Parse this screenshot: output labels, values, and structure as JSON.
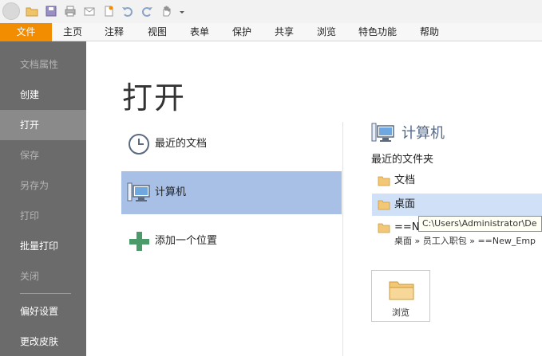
{
  "ribbon": {
    "tabs": [
      "文件",
      "主页",
      "注释",
      "视图",
      "表单",
      "保护",
      "共享",
      "浏览",
      "特色功能",
      "帮助"
    ]
  },
  "sidebar": {
    "items": [
      {
        "label": "文档属性",
        "state": "disabled"
      },
      {
        "label": "创建",
        "state": "normal"
      },
      {
        "label": "打开",
        "state": "active"
      },
      {
        "label": "保存",
        "state": "disabled"
      },
      {
        "label": "另存为",
        "state": "disabled"
      },
      {
        "label": "打印",
        "state": "disabled"
      },
      {
        "label": "批量打印",
        "state": "normal"
      },
      {
        "label": "关闭",
        "state": "disabled"
      },
      {
        "label": "偏好设置",
        "state": "normal"
      },
      {
        "label": "更改皮肤",
        "state": "normal"
      }
    ]
  },
  "main": {
    "title": "打开",
    "places": [
      {
        "label": "最近的文档",
        "icon": "clock-icon"
      },
      {
        "label": "计算机",
        "icon": "computer-icon"
      },
      {
        "label": "添加一个位置",
        "icon": "plus-icon"
      }
    ]
  },
  "computer_panel": {
    "heading": "计算机",
    "recent_folders_label": "最近的文件夹",
    "folders": [
      {
        "name": "文档"
      },
      {
        "name": "桌面"
      },
      {
        "name": "==N"
      }
    ],
    "folder_path": "桌面 » 员工入职包 » ==New_Emp",
    "tooltip": "C:\\Users\\Administrator\\De",
    "browse_label": "浏览"
  },
  "colors": {
    "file_tab": "#f28c00",
    "sidebar_bg": "#6b6b6b",
    "selected_place": "#a8c0e6",
    "heading": "#556a8a"
  }
}
